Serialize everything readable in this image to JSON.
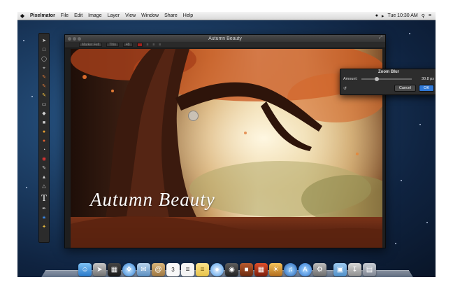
{
  "menubar": {
    "app_name": "Pixelmator",
    "items": [
      "File",
      "Edit",
      "Image",
      "Layer",
      "View",
      "Window",
      "Share",
      "Help"
    ],
    "clock": "Tue 10:30 AM"
  },
  "window": {
    "title": "Autumn Beauty"
  },
  "options_bar": {
    "font": "Marker Felt",
    "style": "Thin",
    "size": "48"
  },
  "canvas": {
    "overlay_text": "Autumn Beauty"
  },
  "zoom_blur": {
    "title": "Zoom Blur",
    "amount_label": "Amount:",
    "amount_value": "30.8 px",
    "amount_fraction": 0.3,
    "cancel_label": "Cancel",
    "ok_label": "OK"
  },
  "tools": [
    "arrow-icon",
    "marquee-icon",
    "lasso-icon",
    "crop-icon",
    "eyedropper-icon",
    "brush-icon",
    "pencil-icon",
    "eraser-icon",
    "bucket-icon",
    "gradient-icon",
    "smudge-icon",
    "sponge-icon",
    "dodge-icon",
    "red-eye-icon",
    "clone-icon",
    "blur-icon",
    "sharpen-icon",
    "type-icon",
    "pen-icon",
    "shape-star-icon",
    "magic-wand-icon"
  ],
  "dock": [
    "finder-icon",
    "launchpad-icon",
    "mission-control-icon",
    "safari-icon",
    "mail-icon",
    "contacts-icon",
    "calendar-icon",
    "reminders-icon",
    "notes-icon",
    "messages-icon",
    "facetime-icon",
    "photo-booth-icon",
    "pixelmator-icon",
    "iphoto-icon",
    "itunes-icon",
    "app-store-icon",
    "preferences-icon",
    "folder-icon",
    "downloads-icon",
    "trash-icon"
  ],
  "colors": {
    "ok_button": "#2f78d6"
  }
}
